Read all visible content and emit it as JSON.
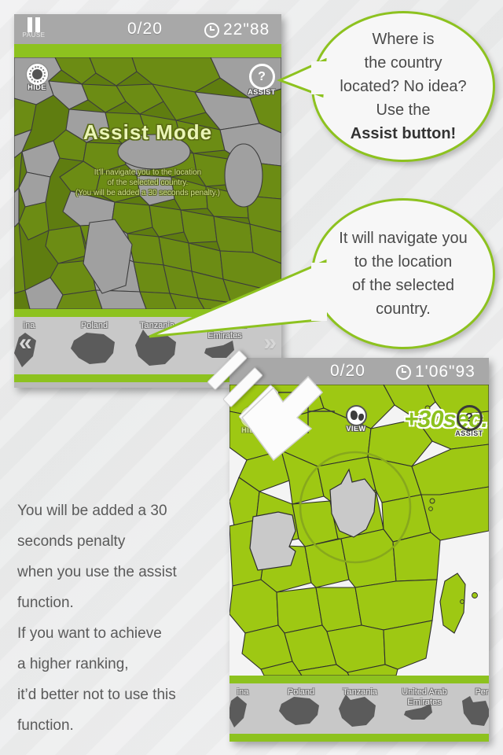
{
  "screen1": {
    "pause_label": "PAUSE",
    "score": "0/20",
    "time": "22\"88",
    "hide_label": "HIDE",
    "assist_label": "ASSIST",
    "overlay_title": "Assist Mode",
    "overlay_line1": "It'll navigate you to the location",
    "overlay_line2": "of the selected country.",
    "overlay_line3": "(You will be added a 30 seconds penalty.)",
    "prev_icon": "chevron-left-double",
    "next_icon": "chevron-right-double",
    "countries": [
      "ina",
      "Poland",
      "Tanzania",
      "United Arab Emirates"
    ]
  },
  "screen2": {
    "score": "0/20",
    "time": "1'06\"93",
    "view_label": "VIEW",
    "assist_label": "ASSIST",
    "hide_label": "HIDE",
    "penalty_badge": "+30sec.",
    "countries": [
      "ina",
      "Poland",
      "Tanzania",
      "United Arab Emirates",
      "Per"
    ]
  },
  "bubbles": [
    {
      "line1": "Where is",
      "line2": "the country",
      "line3": "located? No idea?",
      "line4": "Use the",
      "line5_bold": "Assist button!"
    },
    {
      "line1": "It will navigate you",
      "line2": "to the location",
      "line3": "of the selected",
      "line4": "country."
    }
  ],
  "body": {
    "line1": "You will be added a 30",
    "line2": "seconds penalty",
    "line3": "when you use the assist",
    "line4": "function.",
    "line5": " If you want to achieve",
    "line6": "a higher ranking,",
    "line7": "it’d better not to use this",
    "line8": "function."
  },
  "colors": {
    "accent_green": "#8dc21f",
    "map_dark_green": "#5f7d10",
    "map_gray": "#a0a0a0",
    "bar_gray": "#a8a8a8",
    "strip_gray": "#c8c8c8",
    "text_gray": "#5a5a5a"
  }
}
